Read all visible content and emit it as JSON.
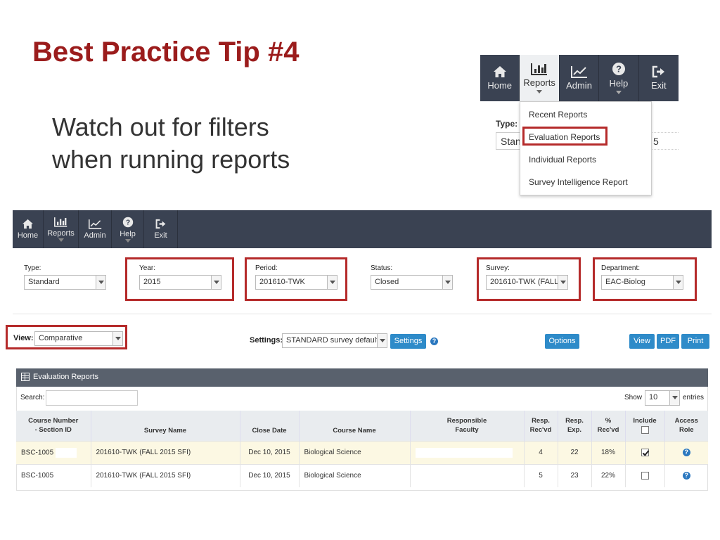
{
  "slide": {
    "title": "Best Practice Tip #4",
    "subtitle_line1": "Watch out for filters",
    "subtitle_line2": "when running reports"
  },
  "nav": {
    "items": [
      {
        "label": "Home",
        "icon": "home-icon"
      },
      {
        "label": "Reports",
        "icon": "bar-chart-icon"
      },
      {
        "label": "Admin",
        "icon": "line-chart-icon"
      },
      {
        "label": "Help",
        "icon": "question-icon"
      },
      {
        "label": "Exit",
        "icon": "exit-icon"
      }
    ]
  },
  "inset": {
    "type_label": "Type:",
    "type_value_partial": "Stan",
    "year_value_partial": "5",
    "menu": [
      "Recent Reports",
      "Evaluation Reports",
      "Individual Reports",
      "Survey Intelligence Report"
    ],
    "highlighted_item": "Evaluation Reports"
  },
  "filters": {
    "type": {
      "label": "Type:",
      "value": "Standard"
    },
    "year": {
      "label": "Year:",
      "value": "2015"
    },
    "period": {
      "label": "Period:",
      "value": "201610-TWK"
    },
    "status": {
      "label": "Status:",
      "value": "Closed"
    },
    "survey": {
      "label": "Survey:",
      "value": "201610-TWK (FALL"
    },
    "department": {
      "label": "Department:",
      "value": "EAC-Biolog"
    }
  },
  "toolbar": {
    "view_label": "View:",
    "view_value": "Comparative",
    "settings_label": "Settings:",
    "settings_value": "STANDARD survey default",
    "settings_button": "Settings",
    "options_button": "Options",
    "view_button": "View",
    "pdf_button": "PDF",
    "print_button": "Print"
  },
  "panel": {
    "title": "Evaluation Reports",
    "search_label": "Search:",
    "show_label": "Show",
    "show_value": "10",
    "entries_label": "entries"
  },
  "table": {
    "headers": {
      "course_number_1": "Course Number",
      "course_number_2": "- Section ID",
      "survey_name": "Survey Name",
      "close_date": "Close Date",
      "course_name": "Course Name",
      "faculty_1": "Responsible",
      "faculty_2": "Faculty",
      "resp_recvd_1": "Resp.",
      "resp_recvd_2": "Rec'vd",
      "resp_exp_1": "Resp.",
      "resp_exp_2": "Exp.",
      "pct_1": "%",
      "pct_2": "Rec'vd",
      "include": "Include",
      "access_1": "Access",
      "access_2": "Role"
    },
    "rows": [
      {
        "course": "BSC-1005",
        "survey": "201610-TWK (FALL 2015 SFI)",
        "close": "Dec 10, 2015",
        "course_name": "Biological Science",
        "recvd": "4",
        "exp": "22",
        "pct": "18%",
        "include": true
      },
      {
        "course": "BSC-1005",
        "survey": "201610-TWK (FALL 2015 SFI)",
        "close": "Dec 10, 2015",
        "course_name": "Biological Science",
        "recvd": "5",
        "exp": "23",
        "pct": "22%",
        "include": false
      }
    ]
  },
  "colors": {
    "title_red": "#9b1c1c",
    "highlight_red": "#b52a2a",
    "nav_bg": "#3a4252",
    "button_blue": "#2e8bc9",
    "row_highlight": "#fcf8e3"
  }
}
